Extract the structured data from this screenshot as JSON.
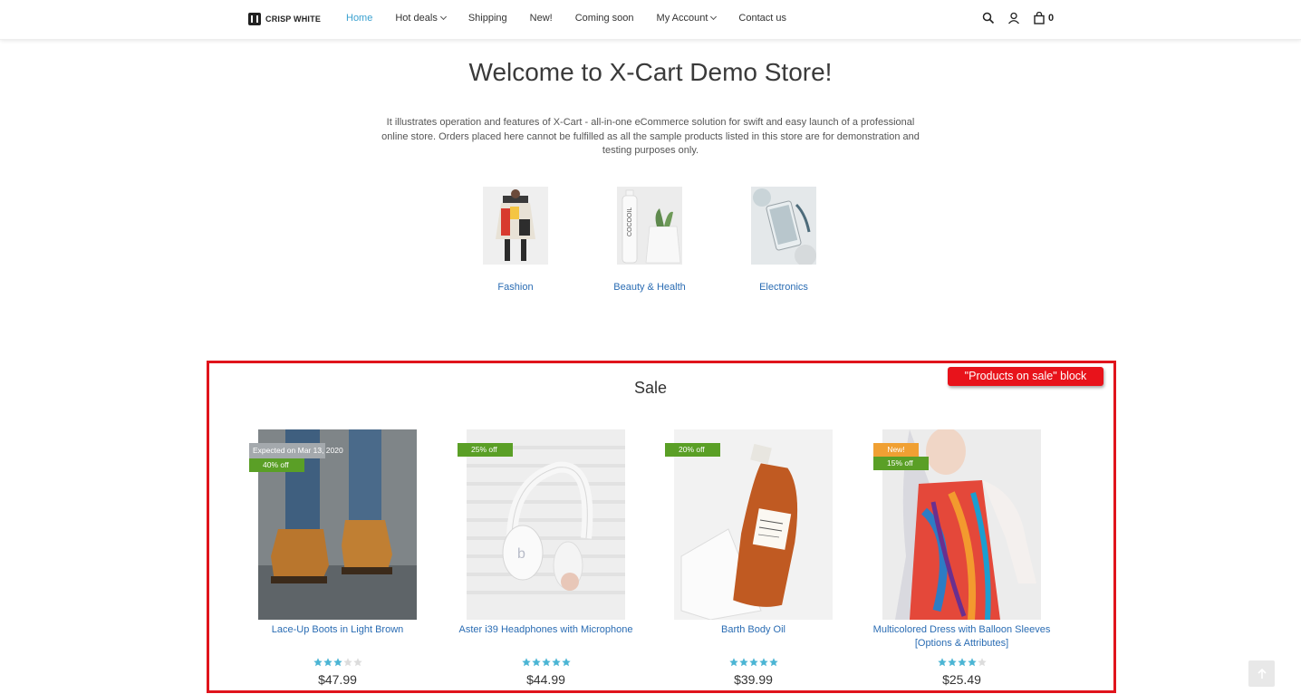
{
  "header": {
    "logo_text": "CRISP WHITE",
    "nav": [
      {
        "label": "Home",
        "active": true,
        "dropdown": false
      },
      {
        "label": "Hot deals",
        "active": false,
        "dropdown": true
      },
      {
        "label": "Shipping",
        "active": false,
        "dropdown": false
      },
      {
        "label": "New!",
        "active": false,
        "dropdown": false
      },
      {
        "label": "Coming soon",
        "active": false,
        "dropdown": false
      },
      {
        "label": "My Account",
        "active": false,
        "dropdown": true
      },
      {
        "label": "Contact us",
        "active": false,
        "dropdown": false
      }
    ],
    "cart_count": "0"
  },
  "hero": {
    "title": "Welcome to X-Cart Demo Store!",
    "text": "It illustrates operation and features of X-Cart - all-in-one eCommerce solution for swift and easy launch of a professional online store. Orders placed here cannot be fulfilled as all the sample products listed in this store are for demonstration and testing purposes only."
  },
  "categories": [
    {
      "label": "Fashion"
    },
    {
      "label": "Beauty & Health"
    },
    {
      "label": "Electronics"
    }
  ],
  "sale": {
    "title": "Sale",
    "callout": "\"Products on sale\" block",
    "products": [
      {
        "name": "Lace-Up Boots in Light Brown",
        "badges": [
          "Expected on Mar 13, 2020",
          "40% off"
        ],
        "rating": 3,
        "price": "$47.99"
      },
      {
        "name": "Aster i39 Headphones with Microphone",
        "badges": [
          "25% off"
        ],
        "rating": 5,
        "price": "$44.99"
      },
      {
        "name": "Barth Body Oil",
        "badges": [
          "20% off"
        ],
        "rating": 5,
        "price": "$39.99"
      },
      {
        "name": "Multicolored Dress with Balloon Sleeves [Options & Attributes]",
        "badges": [
          "New!",
          "15% off"
        ],
        "rating": 4,
        "price": "$25.49"
      }
    ]
  },
  "colors": {
    "accent": "#3aa1d0",
    "link": "#2a6cb3",
    "sale_green": "#5a9f26",
    "new_orange": "#f0a033",
    "annotation_red": "#e0141c"
  }
}
